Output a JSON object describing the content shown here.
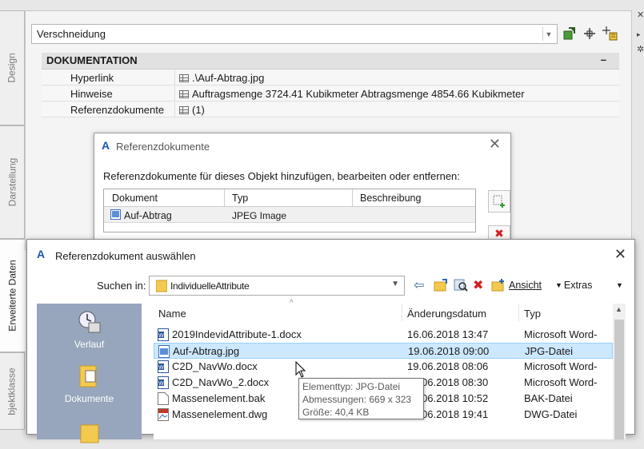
{
  "side_tabs": [
    "Design",
    "Darstellung",
    "Erweiterte Daten",
    "bjektklasse"
  ],
  "palette": {
    "object_select": "Verschneidung",
    "category": "DOKUMENTATION",
    "collapse_symbol": "–",
    "properties": [
      {
        "key": "Hyperlink",
        "value": ".\\Auf-Abtrag.jpg"
      },
      {
        "key": "Hinweise",
        "value": "Auftragsmenge  3724.41 Kubikmeter Abtragsmenge  4854.66 Kubikmeter"
      },
      {
        "key": "Referenzdokumente",
        "value": "(1)"
      }
    ]
  },
  "ref_dialog": {
    "title": "Referenzdokumente",
    "description": "Referenzdokumente für dieses Objekt hinzufügen, bearbeiten oder entfernen:",
    "columns": [
      "Dokument",
      "Typ",
      "Beschreibung"
    ],
    "rows": [
      {
        "document": "Auf-Abtrag",
        "type": "JPEG Image",
        "description": ""
      }
    ]
  },
  "file_dialog": {
    "title": "Referenzdokument auswählen",
    "look_in_label": "Suchen in:",
    "look_in_value": "IndividuelleAttribute",
    "view_label": "Ansicht",
    "extras_label": "Extras",
    "places": [
      "Verlauf",
      "Dokumente"
    ],
    "columns": {
      "name": "Name",
      "date": "Änderungsdatum",
      "type": "Typ"
    },
    "files": [
      {
        "name": "2019IndevidAttribute-1.docx",
        "date": "16.06.2018 13:47",
        "type": "Microsoft Word-"
      },
      {
        "name": "Auf-Abtrag.jpg",
        "date": "19.06.2018 09:00",
        "type": "JPG-Datei"
      },
      {
        "name": "C2D_NavWo.docx",
        "date": "19.06.2018 08:06",
        "type": "Microsoft Word-"
      },
      {
        "name": "C2D_NavWo_2.docx",
        "date": "19.06.2018 08:30",
        "type": "Microsoft Word-"
      },
      {
        "name": "Massenelement.bak",
        "date": "18.06.2018 10:52",
        "type": "BAK-Datei"
      },
      {
        "name": "Massenelement.dwg",
        "date": "18.06.2018 19:41",
        "type": "DWG-Datei"
      }
    ],
    "tooltip": [
      "Elementtyp: JPG-Datei",
      "Abmessungen: 669 x 323",
      "Größe: 40,4 KB"
    ]
  },
  "colors": {
    "accent_blue": "#1a5aa8",
    "selection": "#cce8ff",
    "places_bg": "#97a6bd",
    "delete_red": "#d42020"
  }
}
